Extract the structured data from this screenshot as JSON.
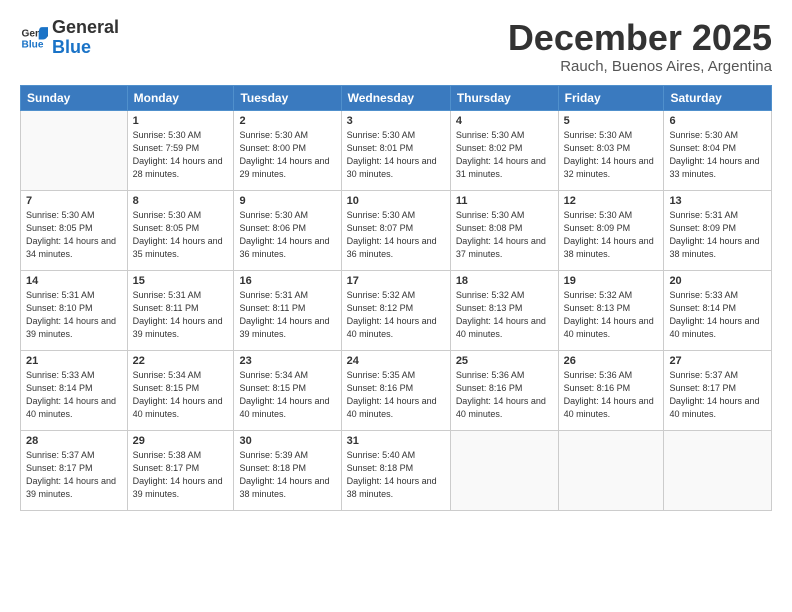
{
  "logo": {
    "general": "General",
    "blue": "Blue"
  },
  "header": {
    "month": "December 2025",
    "location": "Rauch, Buenos Aires, Argentina"
  },
  "weekdays": [
    "Sunday",
    "Monday",
    "Tuesday",
    "Wednesday",
    "Thursday",
    "Friday",
    "Saturday"
  ],
  "weeks": [
    [
      null,
      {
        "day": "1",
        "sunrise": "5:30 AM",
        "sunset": "7:59 PM",
        "daylight": "14 hours and 28 minutes."
      },
      {
        "day": "2",
        "sunrise": "5:30 AM",
        "sunset": "8:00 PM",
        "daylight": "14 hours and 29 minutes."
      },
      {
        "day": "3",
        "sunrise": "5:30 AM",
        "sunset": "8:01 PM",
        "daylight": "14 hours and 30 minutes."
      },
      {
        "day": "4",
        "sunrise": "5:30 AM",
        "sunset": "8:02 PM",
        "daylight": "14 hours and 31 minutes."
      },
      {
        "day": "5",
        "sunrise": "5:30 AM",
        "sunset": "8:03 PM",
        "daylight": "14 hours and 32 minutes."
      },
      {
        "day": "6",
        "sunrise": "5:30 AM",
        "sunset": "8:04 PM",
        "daylight": "14 hours and 33 minutes."
      }
    ],
    [
      {
        "day": "7",
        "sunrise": "5:30 AM",
        "sunset": "8:05 PM",
        "daylight": "14 hours and 34 minutes."
      },
      {
        "day": "8",
        "sunrise": "5:30 AM",
        "sunset": "8:05 PM",
        "daylight": "14 hours and 35 minutes."
      },
      {
        "day": "9",
        "sunrise": "5:30 AM",
        "sunset": "8:06 PM",
        "daylight": "14 hours and 36 minutes."
      },
      {
        "day": "10",
        "sunrise": "5:30 AM",
        "sunset": "8:07 PM",
        "daylight": "14 hours and 36 minutes."
      },
      {
        "day": "11",
        "sunrise": "5:30 AM",
        "sunset": "8:08 PM",
        "daylight": "14 hours and 37 minutes."
      },
      {
        "day": "12",
        "sunrise": "5:30 AM",
        "sunset": "8:09 PM",
        "daylight": "14 hours and 38 minutes."
      },
      {
        "day": "13",
        "sunrise": "5:31 AM",
        "sunset": "8:09 PM",
        "daylight": "14 hours and 38 minutes."
      }
    ],
    [
      {
        "day": "14",
        "sunrise": "5:31 AM",
        "sunset": "8:10 PM",
        "daylight": "14 hours and 39 minutes."
      },
      {
        "day": "15",
        "sunrise": "5:31 AM",
        "sunset": "8:11 PM",
        "daylight": "14 hours and 39 minutes."
      },
      {
        "day": "16",
        "sunrise": "5:31 AM",
        "sunset": "8:11 PM",
        "daylight": "14 hours and 39 minutes."
      },
      {
        "day": "17",
        "sunrise": "5:32 AM",
        "sunset": "8:12 PM",
        "daylight": "14 hours and 40 minutes."
      },
      {
        "day": "18",
        "sunrise": "5:32 AM",
        "sunset": "8:13 PM",
        "daylight": "14 hours and 40 minutes."
      },
      {
        "day": "19",
        "sunrise": "5:32 AM",
        "sunset": "8:13 PM",
        "daylight": "14 hours and 40 minutes."
      },
      {
        "day": "20",
        "sunrise": "5:33 AM",
        "sunset": "8:14 PM",
        "daylight": "14 hours and 40 minutes."
      }
    ],
    [
      {
        "day": "21",
        "sunrise": "5:33 AM",
        "sunset": "8:14 PM",
        "daylight": "14 hours and 40 minutes."
      },
      {
        "day": "22",
        "sunrise": "5:34 AM",
        "sunset": "8:15 PM",
        "daylight": "14 hours and 40 minutes."
      },
      {
        "day": "23",
        "sunrise": "5:34 AM",
        "sunset": "8:15 PM",
        "daylight": "14 hours and 40 minutes."
      },
      {
        "day": "24",
        "sunrise": "5:35 AM",
        "sunset": "8:16 PM",
        "daylight": "14 hours and 40 minutes."
      },
      {
        "day": "25",
        "sunrise": "5:36 AM",
        "sunset": "8:16 PM",
        "daylight": "14 hours and 40 minutes."
      },
      {
        "day": "26",
        "sunrise": "5:36 AM",
        "sunset": "8:16 PM",
        "daylight": "14 hours and 40 minutes."
      },
      {
        "day": "27",
        "sunrise": "5:37 AM",
        "sunset": "8:17 PM",
        "daylight": "14 hours and 40 minutes."
      }
    ],
    [
      {
        "day": "28",
        "sunrise": "5:37 AM",
        "sunset": "8:17 PM",
        "daylight": "14 hours and 39 minutes."
      },
      {
        "day": "29",
        "sunrise": "5:38 AM",
        "sunset": "8:17 PM",
        "daylight": "14 hours and 39 minutes."
      },
      {
        "day": "30",
        "sunrise": "5:39 AM",
        "sunset": "8:18 PM",
        "daylight": "14 hours and 38 minutes."
      },
      {
        "day": "31",
        "sunrise": "5:40 AM",
        "sunset": "8:18 PM",
        "daylight": "14 hours and 38 minutes."
      },
      null,
      null,
      null
    ]
  ]
}
